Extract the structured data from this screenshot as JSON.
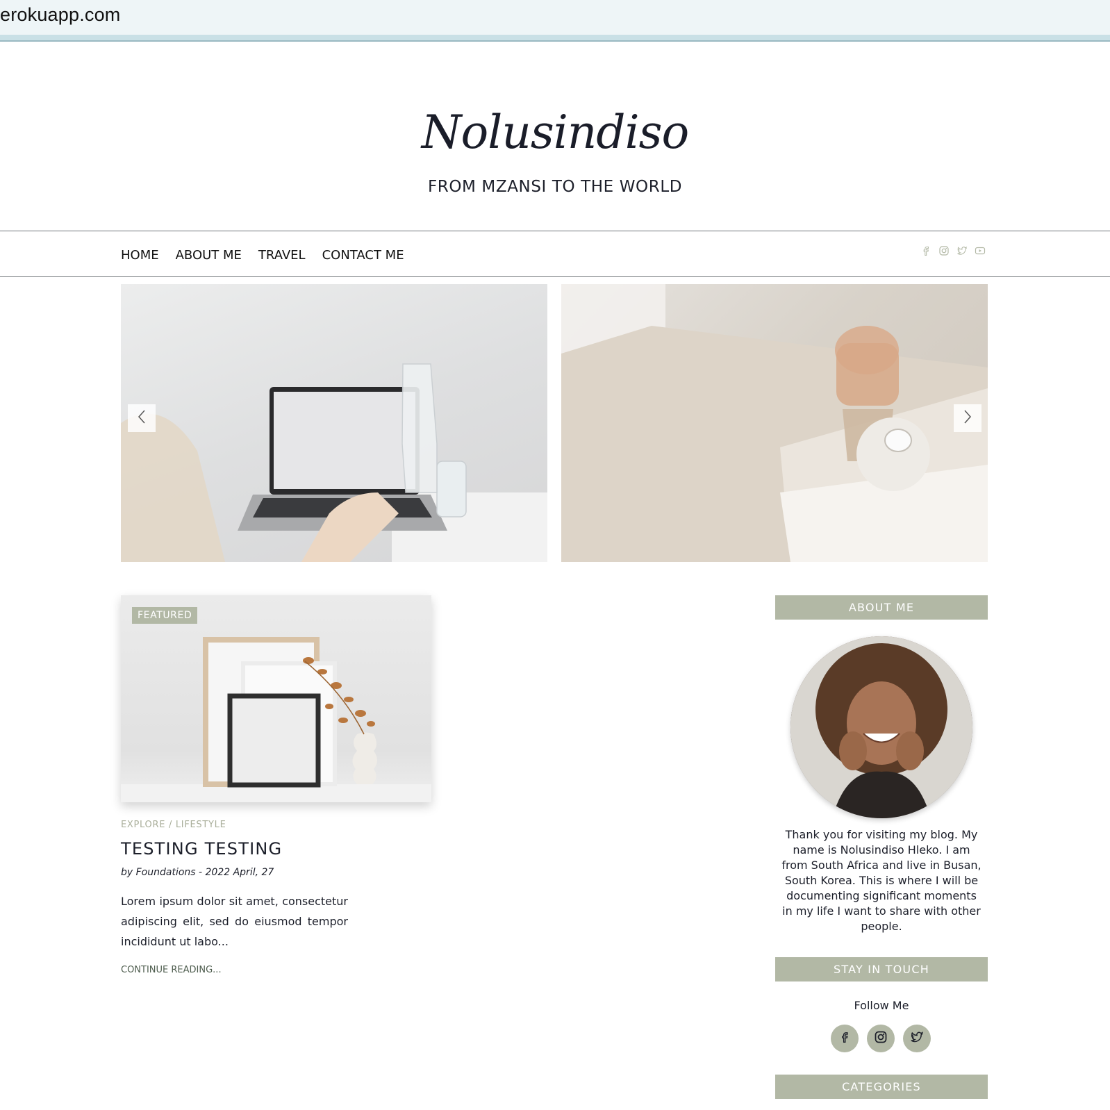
{
  "browser": {
    "url": "erokuapp.com"
  },
  "header": {
    "title": "Nolusindiso",
    "tagline": "FROM MZANSI TO THE WORLD"
  },
  "nav": {
    "links": [
      "HOME",
      "ABOUT ME",
      "TRAVEL",
      "CONTACT ME"
    ],
    "social_icons": [
      "facebook-icon",
      "instagram-icon",
      "twitter-icon",
      "youtube-icon"
    ]
  },
  "slider": {
    "slides": [
      "laptop-on-desk-photo",
      "hourglass-candle-books-photo"
    ],
    "prev_icon": "chevron-left-icon",
    "next_icon": "chevron-right-icon"
  },
  "post": {
    "badge": "FEATURED",
    "category": "EXPLORE / LIFESTYLE",
    "title": "TESTING TESTING",
    "meta": "by Foundations - 2022 April, 27",
    "excerpt": "Lorem ipsum dolor sit amet, consectetur adipiscing elit, sed do eiusmod tempor incididunt ut labo...",
    "more": "CONTINUE READING..."
  },
  "sidebar": {
    "about_heading": "ABOUT ME",
    "about_text": "Thank you for visiting my blog. My name is Nolusindiso Hleko. I am from South Africa and live in Busan, South Korea. This is where I will be documenting significant moments in my life I want to share with other people.",
    "touch_heading": "STAY IN TOUCH",
    "follow_label": "Follow Me",
    "follow_icons": [
      "facebook-icon",
      "instagram-icon",
      "twitter-icon"
    ],
    "categories_heading": "CATEGORIES"
  },
  "colors": {
    "accent_sage": "#b2b8a5",
    "text_dark": "#1c1f2a",
    "category_text": "#a9ae9a"
  }
}
